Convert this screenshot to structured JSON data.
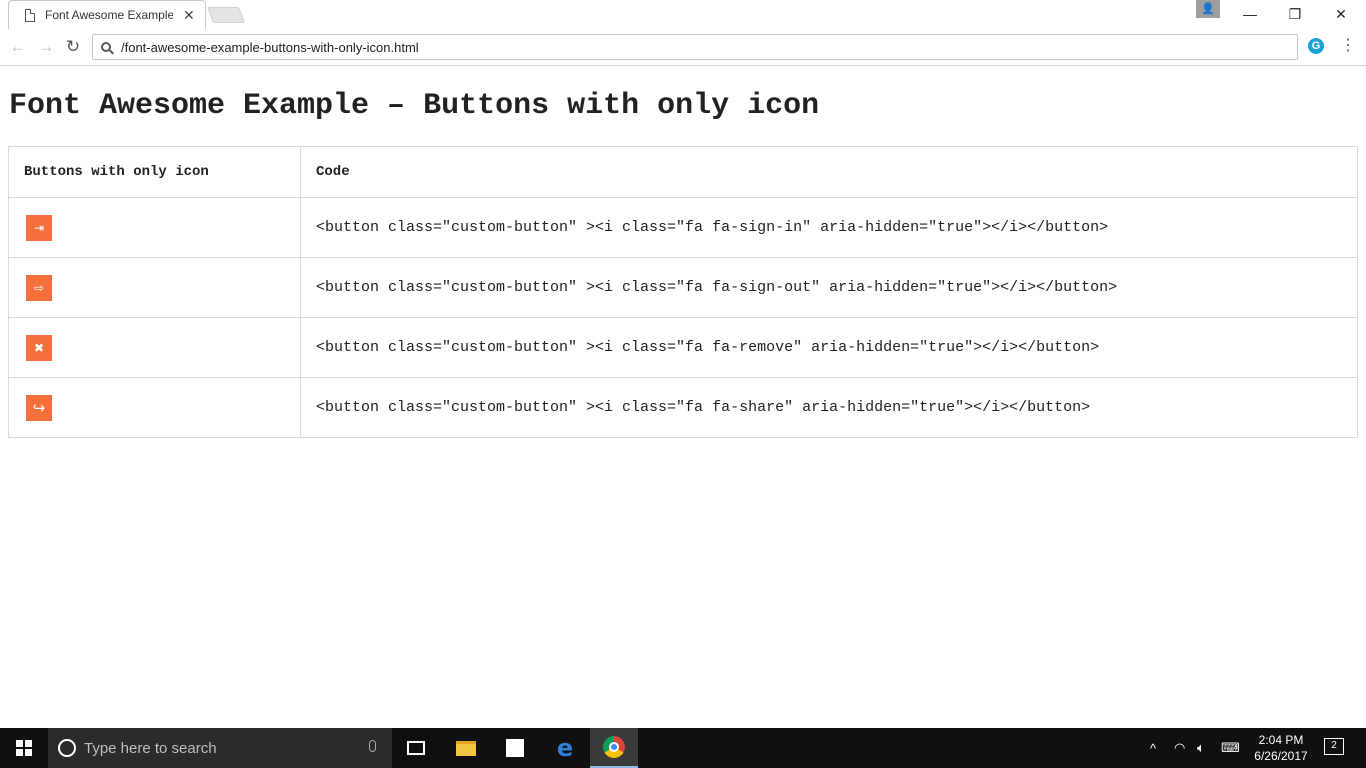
{
  "browser": {
    "tab_title": "Font Awesome Example -",
    "tab_close": "✕",
    "url": "/font-awesome-example-buttons-with-only-icon.html",
    "profile_icon": "👤",
    "minimize": "—",
    "restore": "❐",
    "close": "✕",
    "back": "←",
    "forward": "→",
    "reload": "↻",
    "extension_label": "G",
    "menu": "⋮"
  },
  "page": {
    "title": "Font Awesome Example – Buttons with only icon",
    "table": {
      "headers": [
        "Buttons with only icon",
        "Code"
      ],
      "rows": [
        {
          "icon": "sign-in-icon",
          "glyph": "⇥",
          "code": "<button class=\"custom-button\" ><i class=\"fa fa-sign-in\" aria-hidden=\"true\"></i></button>"
        },
        {
          "icon": "sign-out-icon",
          "glyph": "⇨",
          "code": "<button class=\"custom-button\" ><i class=\"fa fa-sign-out\" aria-hidden=\"true\"></i></button>"
        },
        {
          "icon": "remove-icon",
          "glyph": "✖",
          "code": "<button class=\"custom-button\" ><i class=\"fa fa-remove\" aria-hidden=\"true\"></i></button>"
        },
        {
          "icon": "share-icon",
          "glyph": "↪",
          "code": "<button class=\"custom-button\" ><i class=\"fa fa-share\" aria-hidden=\"true\"></i></button>"
        }
      ]
    },
    "button_color": "#f36f3c"
  },
  "taskbar": {
    "search_placeholder": "Type here to search",
    "time": "2:04 PM",
    "date": "6/26/2017",
    "notification_count": "2"
  }
}
